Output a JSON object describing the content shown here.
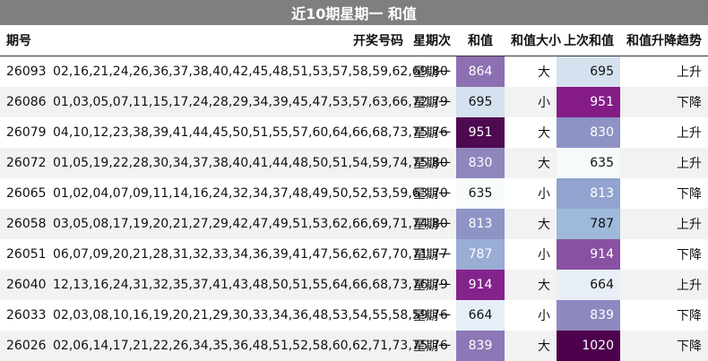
{
  "title": "近10期星期一 和值",
  "headers": {
    "issue": "期号",
    "numbers": "开奖号码",
    "weekday": "星期次",
    "sum": "和值",
    "size": "和值大小",
    "prev_sum": "上次和值",
    "trend": "和值升降趋势"
  },
  "colors": {
    "title_bar": "#7f7f7f",
    "row_alt": "#f2f2f2",
    "scale_low": "#f7fbfc",
    "scale_high": "#4d004b"
  },
  "rows": [
    {
      "issue": "26093",
      "numbers": "02,16,21,24,26,36,37,38,40,42,45,48,51,53,57,58,59,62,69,80",
      "weekday": "星期一",
      "sum": "864",
      "sum_bg": "#8c70b1",
      "sum_fg": "#ffffff",
      "size": "大",
      "prev_sum": "695",
      "prev_bg": "#d4e1ee",
      "prev_fg": "#111111",
      "trend": "上升"
    },
    {
      "issue": "26086",
      "numbers": "01,03,05,07,11,15,17,24,28,29,34,39,45,47,53,57,63,66,72,79",
      "weekday": "星期一",
      "sum": "695",
      "sum_bg": "#d4e1ee",
      "sum_fg": "#111111",
      "size": "小",
      "prev_sum": "951",
      "prev_bg": "#851c86",
      "prev_fg": "#ffffff",
      "trend": "下降"
    },
    {
      "issue": "26079",
      "numbers": "04,10,12,23,38,39,41,44,45,50,51,55,57,60,64,66,68,73,75,76",
      "weekday": "星期一",
      "sum": "951",
      "sum_bg": "#4e0a50",
      "sum_fg": "#ffffff",
      "size": "大",
      "prev_sum": "830",
      "prev_bg": "#8e92c5",
      "prev_fg": "#ffffff",
      "trend": "上升"
    },
    {
      "issue": "26072",
      "numbers": "01,05,19,22,28,30,34,37,38,40,41,44,48,50,51,54,59,74,75,80",
      "weekday": "星期一",
      "sum": "830",
      "sum_bg": "#8e86bd",
      "sum_fg": "#ffffff",
      "size": "大",
      "prev_sum": "635",
      "prev_bg": "#f5fafb",
      "prev_fg": "#111111",
      "trend": "上升"
    },
    {
      "issue": "26065",
      "numbers": "01,02,04,07,09,11,14,16,24,32,34,37,48,49,50,52,53,59,63,70",
      "weekday": "星期一",
      "sum": "635",
      "sum_bg": "#f7fbfc",
      "sum_fg": "#111111",
      "size": "小",
      "prev_sum": "813",
      "prev_bg": "#92a3cf",
      "prev_fg": "#ffffff",
      "trend": "下降"
    },
    {
      "issue": "26058",
      "numbers": "03,05,08,17,19,20,21,27,29,42,47,49,51,53,62,66,69,71,74,80",
      "weekday": "星期一",
      "sum": "813",
      "sum_bg": "#8e94c6",
      "sum_fg": "#ffffff",
      "size": "大",
      "prev_sum": "787",
      "prev_bg": "#9eb9d9",
      "prev_fg": "#111111",
      "trend": "上升"
    },
    {
      "issue": "26051",
      "numbers": "06,07,09,20,21,28,31,32,33,34,36,39,41,47,56,62,67,70,71,77",
      "weekday": "星期一",
      "sum": "787",
      "sum_bg": "#99add5",
      "sum_fg": "#ffffff",
      "size": "小",
      "prev_sum": "914",
      "prev_bg": "#8951a2",
      "prev_fg": "#ffffff",
      "trend": "下降"
    },
    {
      "issue": "26040",
      "numbers": "12,13,16,24,31,32,35,37,41,43,48,50,51,55,64,66,68,73,76,79",
      "weekday": "星期一",
      "sum": "914",
      "sum_bg": "#84238c",
      "sum_fg": "#ffffff",
      "size": "大",
      "prev_sum": "664",
      "prev_bg": "#e8eff6",
      "prev_fg": "#111111",
      "trend": "上升"
    },
    {
      "issue": "26033",
      "numbers": "02,03,08,10,16,19,20,21,29,30,33,34,36,48,53,54,55,58,59,76",
      "weekday": "星期一",
      "sum": "664",
      "sum_bg": "#e6eff7",
      "sum_fg": "#111111",
      "size": "小",
      "prev_sum": "839",
      "prev_bg": "#8c89c0",
      "prev_fg": "#ffffff",
      "trend": "下降"
    },
    {
      "issue": "26026",
      "numbers": "02,06,14,17,21,22,26,34,35,36,48,51,52,58,60,62,71,73,75,76",
      "weekday": "星期一",
      "sum": "839",
      "sum_bg": "#8c78b6",
      "sum_fg": "#ffffff",
      "size": "大",
      "prev_sum": "1020",
      "prev_bg": "#4d004b",
      "prev_fg": "#ffffff",
      "trend": "下降"
    }
  ]
}
